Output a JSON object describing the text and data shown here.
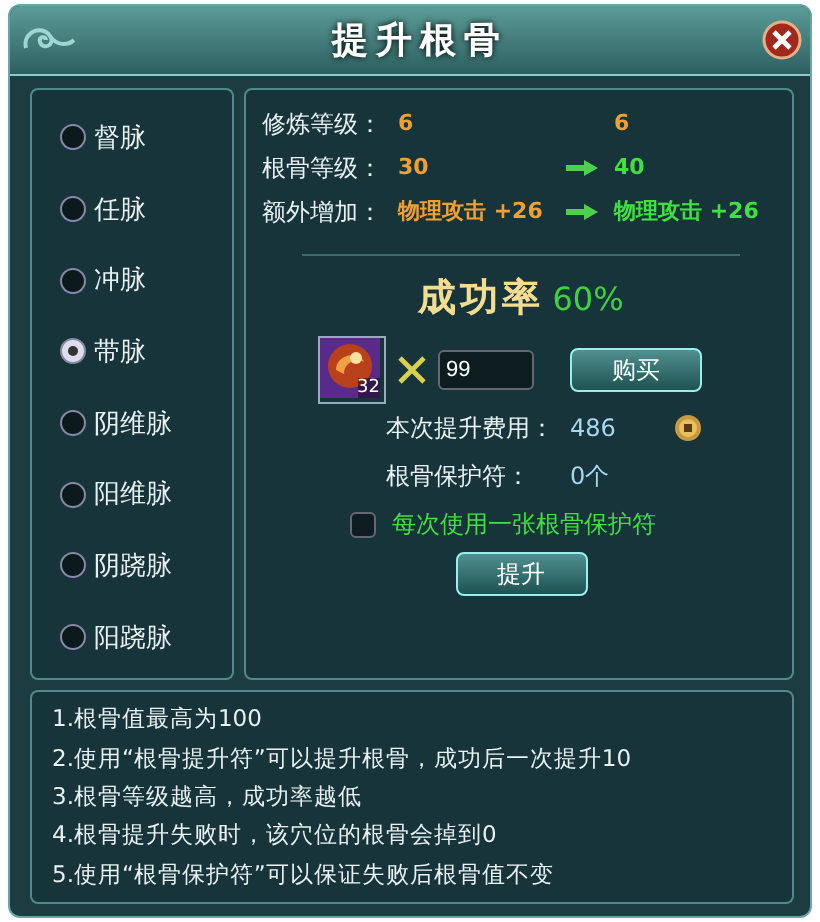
{
  "window": {
    "title": "提升根骨"
  },
  "meridians": [
    {
      "label": "督脉",
      "selected": false
    },
    {
      "label": "任脉",
      "selected": false
    },
    {
      "label": "冲脉",
      "selected": false
    },
    {
      "label": "带脉",
      "selected": true
    },
    {
      "label": "阴维脉",
      "selected": false
    },
    {
      "label": "阳维脉",
      "selected": false
    },
    {
      "label": "阴跷脉",
      "selected": false
    },
    {
      "label": "阳跷脉",
      "selected": false
    }
  ],
  "stats": [
    {
      "label": "修炼等级：",
      "current": "6",
      "next": "6",
      "arrow": false
    },
    {
      "label": "根骨等级：",
      "current": "30",
      "next": "40",
      "arrow": true
    },
    {
      "label": "额外增加：",
      "current": "物理攻击 +26",
      "next": "物理攻击 +26",
      "arrow": true
    }
  ],
  "success": {
    "label": "成功率",
    "value": "60%"
  },
  "item": {
    "count": "32",
    "quantity": "99",
    "buy_button": "购买"
  },
  "cost": {
    "label": "本次提升费用：",
    "value": "486"
  },
  "protection": {
    "label": "根骨保护符：",
    "value": "0个"
  },
  "option": {
    "label": "每次使用一张根骨保护符",
    "checked": false
  },
  "upgrade_button": "提升",
  "notes": [
    "1.根骨值最高为100",
    "2.使用“根骨提升符”可以提升根骨，成功后一次提升10",
    "3.根骨等级越高，成功率越低",
    "4.根骨提升失败时，该穴位的根骨会掉到0",
    "5.使用“根骨保护符”可以保证失败后根骨值不变"
  ]
}
